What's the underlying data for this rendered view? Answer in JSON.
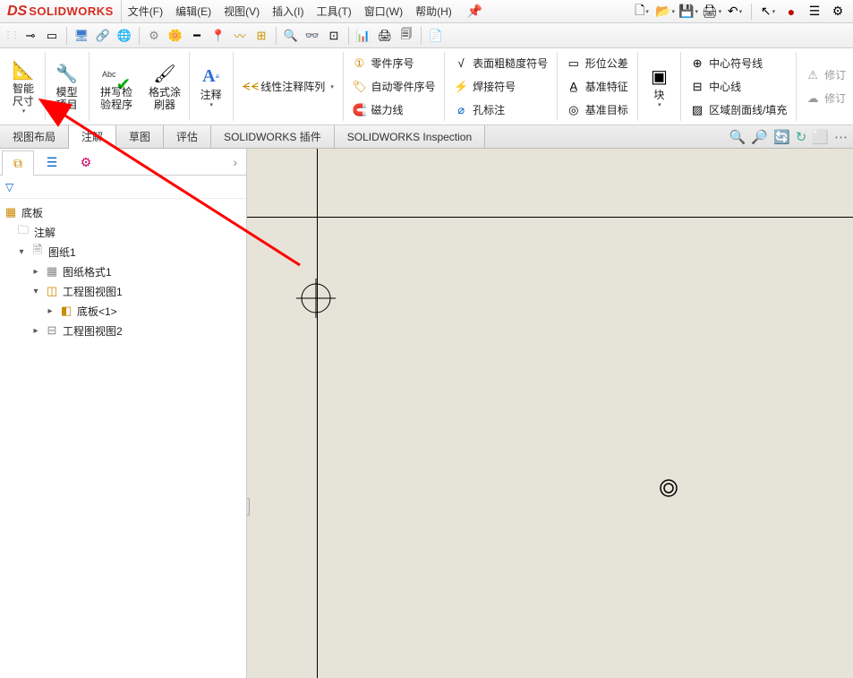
{
  "app": {
    "name": "SOLIDWORKS"
  },
  "menus": [
    "文件(F)",
    "编辑(E)",
    "视图(V)",
    "插入(I)",
    "工具(T)",
    "窗口(W)",
    "帮助(H)"
  ],
  "ribbon": {
    "large": [
      {
        "icon": "📐",
        "label": "智能尺寸"
      },
      {
        "icon": "🔧",
        "label": "模型项目"
      },
      {
        "icon": "✔",
        "label": "拼写检验程序",
        "iconColor": "#0a0"
      },
      {
        "icon": "🖌",
        "label": "格式涂刷器"
      },
      {
        "icon": "A",
        "label": "注释",
        "iconColor": "#2a6fd6"
      }
    ],
    "col1": [
      {
        "icon": "🔍",
        "label": "线性注释阵列"
      }
    ],
    "col2": [
      {
        "icon": "①",
        "label": "零件序号"
      },
      {
        "icon": "🏷",
        "label": "自动零件序号"
      },
      {
        "icon": "🧲",
        "label": "磁力线"
      }
    ],
    "col3": [
      {
        "icon": "√",
        "label": "表面粗糙度符号"
      },
      {
        "icon": "⚡",
        "label": "焊接符号"
      },
      {
        "icon": "⊕",
        "label": "孔标注"
      }
    ],
    "col4": [
      {
        "icon": "▭",
        "label": "形位公差"
      },
      {
        "icon": "A̲",
        "label": "基准特征"
      },
      {
        "icon": "◎",
        "label": "基准目标"
      }
    ],
    "col5": [
      {
        "icon": "▣",
        "label": "块"
      }
    ],
    "col6": [
      {
        "icon": "⊕",
        "label": "中心符号线"
      },
      {
        "icon": "⊟",
        "label": "中心线"
      },
      {
        "icon": "▨",
        "label": "区域剖面线/填充"
      }
    ],
    "col7": [
      {
        "icon": "⚠",
        "label": "修订"
      },
      {
        "icon": "☁",
        "label": "修订"
      }
    ]
  },
  "tabs": [
    "视图布局",
    "注解",
    "草图",
    "评估",
    "SOLIDWORKS 插件",
    "SOLIDWORKS Inspection"
  ],
  "activeTab": "注解",
  "tree": {
    "root": "底板",
    "annotations": "注解",
    "sheet": "图纸1",
    "sheetFormat": "图纸格式1",
    "view1": "工程图视图1",
    "partRef": "底板<1>",
    "view2": "工程图视图2"
  }
}
